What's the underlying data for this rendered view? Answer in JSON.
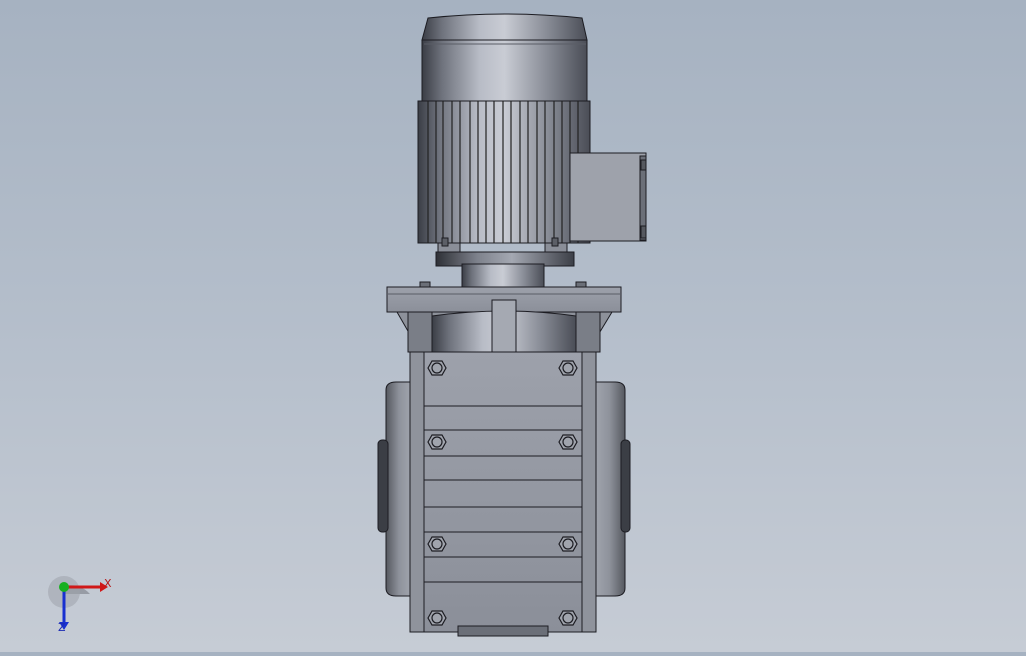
{
  "viewport": {
    "background_top": "#a6b2c1",
    "background_bottom": "#c6ccd5"
  },
  "model": {
    "description_icon": "gearmotor-model-icon",
    "body_color": "#8f939d",
    "edge_color": "#1c1c22"
  },
  "triad": {
    "x_label": "X",
    "z_label": "Z",
    "x_color": "#d01818",
    "y_color": "#18b020",
    "z_color": "#1830d0"
  }
}
